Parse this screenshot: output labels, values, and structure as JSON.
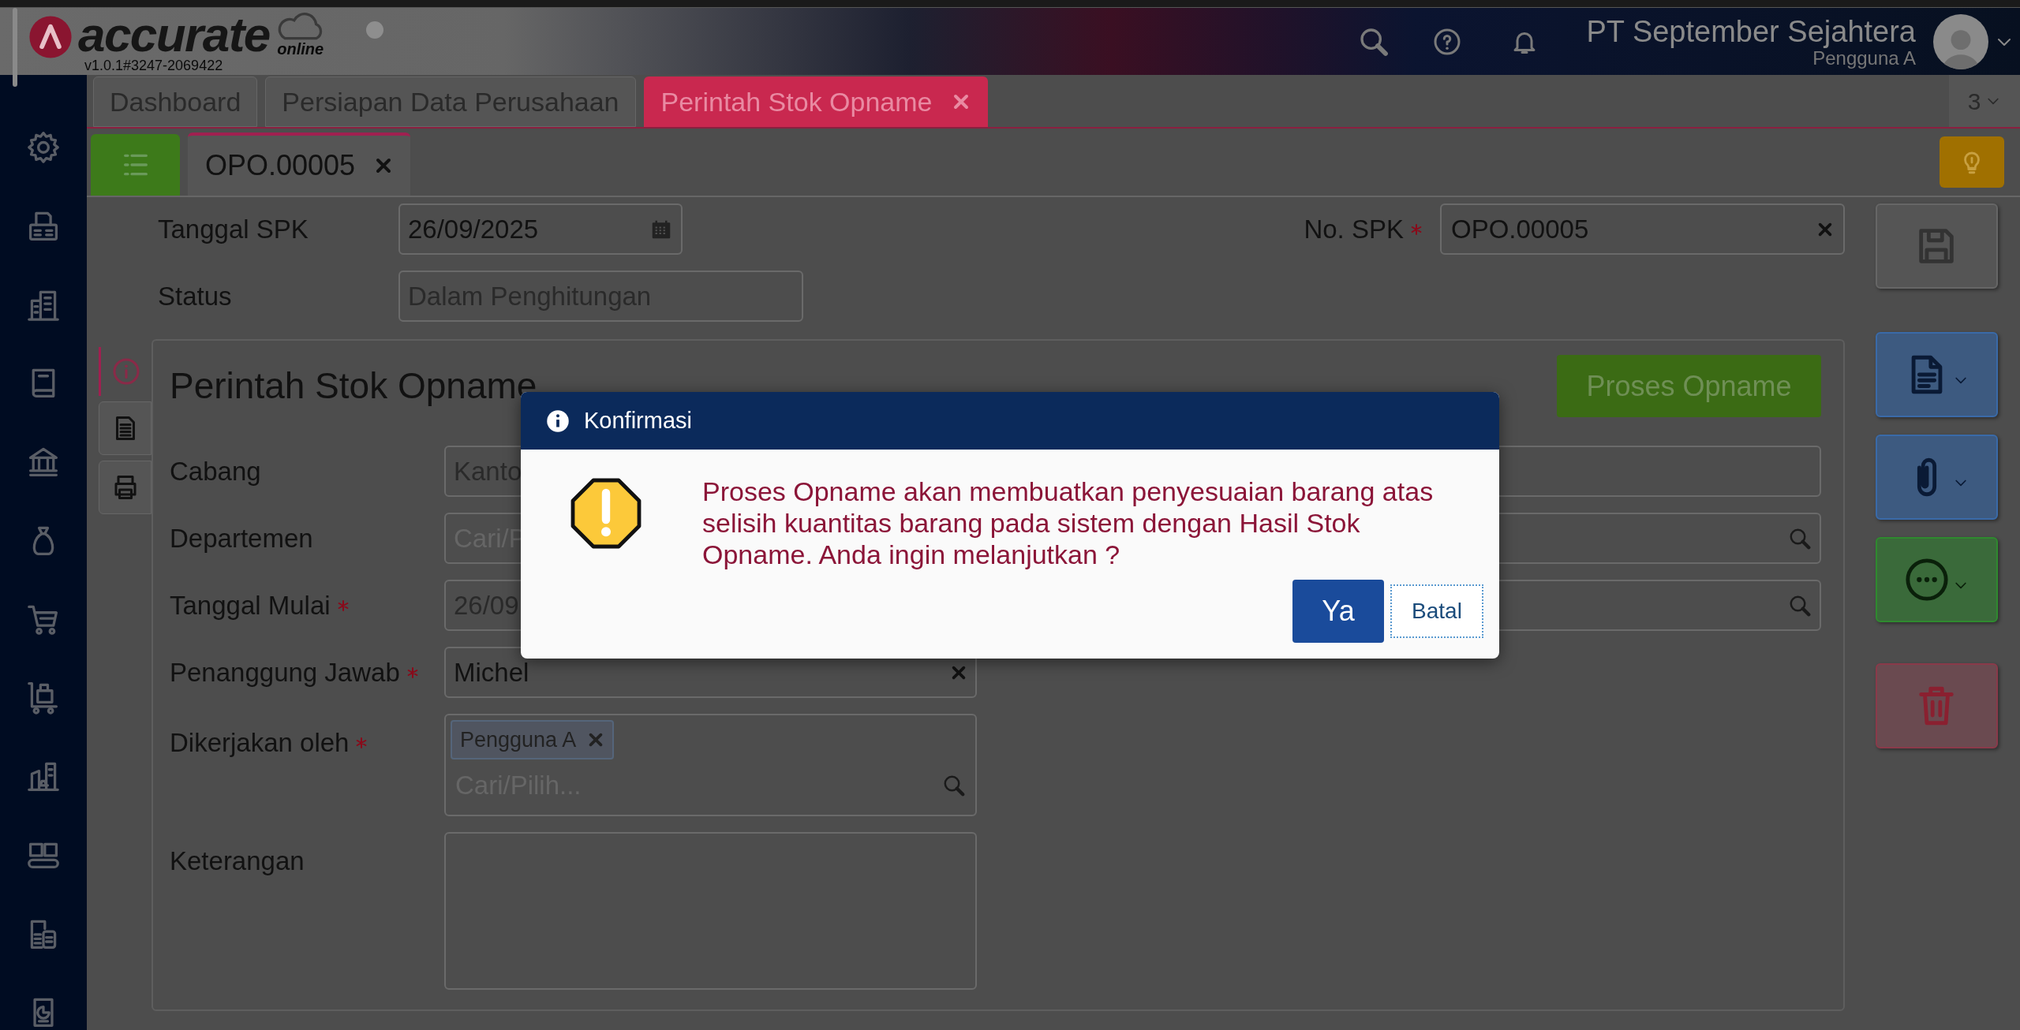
{
  "header": {
    "logo_text": "accurate",
    "logo_sub": "online",
    "version": "v1.0.1#3247-2069422",
    "company": "PT September Sejahtera",
    "user": "Pengguna A"
  },
  "tabs": [
    {
      "label": "Dashboard",
      "selected": false,
      "closable": false
    },
    {
      "label": "Persiapan Data Perusahaan",
      "selected": false,
      "closable": false
    },
    {
      "label": "Perintah Stok Opname",
      "selected": true,
      "closable": true
    }
  ],
  "tab_count": "3",
  "doc_tabs": [
    {
      "label": "OPO.00005",
      "selected": true
    }
  ],
  "top_fields": [
    {
      "label": "Tanggal SPK",
      "value": "26/09/2025",
      "kind": "date"
    },
    {
      "label": "Status",
      "value": "Dalam Penghitungan",
      "kind": "readonly"
    }
  ],
  "no_spk": {
    "label": "No. SPK",
    "required": true,
    "value": "OPO.00005"
  },
  "panel": {
    "title": "Perintah Stok Opname",
    "action": "Proses Opname",
    "side_tabs": [
      {
        "selected": true
      },
      {
        "selected": false
      },
      {
        "selected": false
      }
    ],
    "fields": [
      {
        "label": "Cabang",
        "required": false,
        "kind": "text",
        "value": "Kanto"
      },
      {
        "label": "Departemen",
        "required": false,
        "kind": "search",
        "placeholder": "Cari/P"
      },
      {
        "label": "Tanggal Mulai",
        "required": true,
        "kind": "search",
        "value": "26/09"
      },
      {
        "label": "Penanggung Jawab",
        "required": true,
        "kind": "clearable",
        "value": "Michel"
      },
      {
        "label": "Dikerjakan oleh",
        "required": true,
        "kind": "multi",
        "chips": [
          "Pengguna A"
        ],
        "placeholder": "Cari/Pilih..."
      },
      {
        "label": "Keterangan",
        "required": false,
        "kind": "textarea"
      }
    ]
  },
  "dialog": {
    "title": "Konfirmasi",
    "message": "Proses Opname akan membuatkan penyesuaian barang atas selisih kuantitas barang pada sistem dengan Hasil Stok Opname. Anda ingin melanjutkan ?",
    "buttons": [
      {
        "label": "Ya",
        "kind": "primary"
      },
      {
        "label": "Batal",
        "kind": "secondary"
      }
    ]
  }
}
